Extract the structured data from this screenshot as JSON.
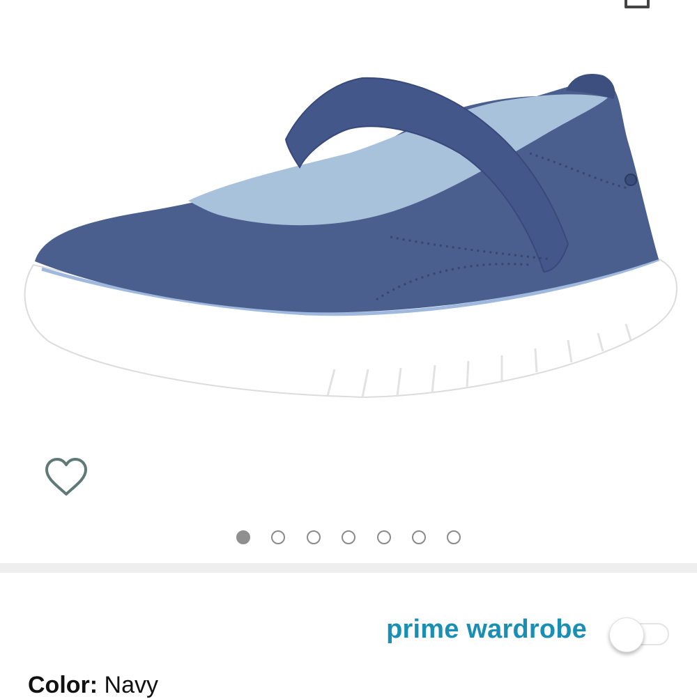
{
  "gallery": {
    "image_alt": "Navy suede mary jane sneaker with white sole",
    "image_count": 7,
    "active_index": 0
  },
  "prime_wardrobe": {
    "label": "prime wardrobe",
    "enabled": false,
    "accent_color": "#1a8fb4"
  },
  "color": {
    "label": "Color:",
    "value": "Navy"
  },
  "icons": {
    "wishlist": "heart-outline-icon",
    "top": "share-icon"
  }
}
